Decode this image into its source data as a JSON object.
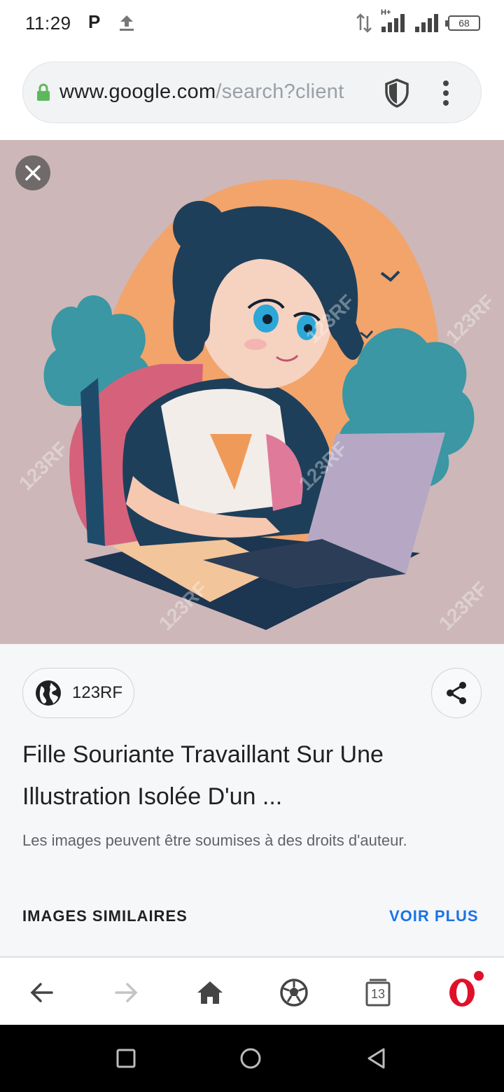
{
  "status_bar": {
    "time": "11:29",
    "carrier_icon": "P",
    "network": "H+",
    "battery": "68"
  },
  "url_bar": {
    "domain": "www.google.com",
    "path": "/search?client"
  },
  "image": {
    "watermark": "123RF"
  },
  "info": {
    "source": "123RF",
    "title": "Fille Souriante Travaillant Sur Une Illustration Isolée D'un ...",
    "copyright": "Les images peuvent être soumises à des droits d'auteur.",
    "similar_label": "IMAGES SIMILAIRES",
    "see_more_label": "VOIR PLUS"
  },
  "browser_bar": {
    "tabs_count": "13"
  },
  "colors": {
    "accent": "#1a73e8",
    "image_background": "#cdb7b8",
    "opera_red": "#e0102a"
  }
}
